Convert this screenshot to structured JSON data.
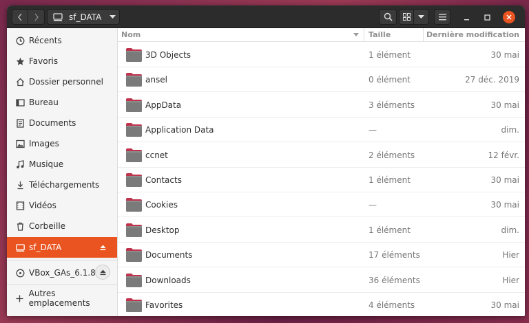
{
  "window": {
    "location_label": "sf_DATA"
  },
  "sidebar": {
    "items": [
      {
        "label": "Récents",
        "icon": "clock-icon"
      },
      {
        "label": "Favoris",
        "icon": "star-icon"
      },
      {
        "label": "Dossier personnel",
        "icon": "home-icon"
      },
      {
        "label": "Bureau",
        "icon": "desktop-icon"
      },
      {
        "label": "Documents",
        "icon": "document-icon"
      },
      {
        "label": "Images",
        "icon": "image-icon"
      },
      {
        "label": "Musique",
        "icon": "music-icon"
      },
      {
        "label": "Téléchargements",
        "icon": "download-icon"
      },
      {
        "label": "Vidéos",
        "icon": "video-icon"
      },
      {
        "label": "Corbeille",
        "icon": "trash-icon"
      },
      {
        "label": "sf_DATA",
        "icon": "drive-icon"
      }
    ],
    "devices": [
      {
        "label": "VBox_GAs_6.1.8",
        "icon": "disc-icon"
      }
    ],
    "other_locations": {
      "label": "Autres emplacements",
      "icon": "plus-icon"
    }
  },
  "columns": {
    "name": "Nom",
    "size": "Taille",
    "modified": "Dernière modification"
  },
  "files": [
    {
      "name": "3D Objects",
      "size": "1 élément",
      "modified": "30 mai"
    },
    {
      "name": "ansel",
      "size": "0 élément",
      "modified": "27 déc. 2019"
    },
    {
      "name": "AppData",
      "size": "3 éléments",
      "modified": "30 mai"
    },
    {
      "name": "Application Data",
      "size": "—",
      "modified": "dim."
    },
    {
      "name": "ccnet",
      "size": "2 éléments",
      "modified": "12 févr."
    },
    {
      "name": "Contacts",
      "size": "1 élément",
      "modified": "30 mai"
    },
    {
      "name": "Cookies",
      "size": "—",
      "modified": "30 mai"
    },
    {
      "name": "Desktop",
      "size": "1 élément",
      "modified": "dim."
    },
    {
      "name": "Documents",
      "size": "17 éléments",
      "modified": "Hier"
    },
    {
      "name": "Downloads",
      "size": "36 éléments",
      "modified": "Hier"
    },
    {
      "name": "Favorites",
      "size": "4 éléments",
      "modified": "30 mai"
    }
  ],
  "colors": {
    "accent": "#e95420",
    "folder": "#7a7a7a",
    "folder_tab": "#c0334d"
  }
}
